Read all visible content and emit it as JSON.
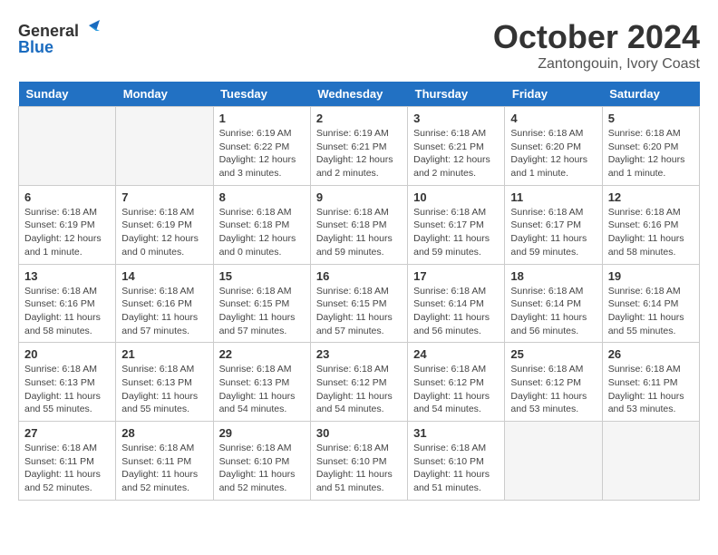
{
  "logo": {
    "line1": "General",
    "line2": "Blue"
  },
  "title": "October 2024",
  "location": "Zantongouin, Ivory Coast",
  "weekdays": [
    "Sunday",
    "Monday",
    "Tuesday",
    "Wednesday",
    "Thursday",
    "Friday",
    "Saturday"
  ],
  "weeks": [
    [
      {
        "day": "",
        "detail": ""
      },
      {
        "day": "",
        "detail": ""
      },
      {
        "day": "1",
        "detail": "Sunrise: 6:19 AM\nSunset: 6:22 PM\nDaylight: 12 hours\nand 3 minutes."
      },
      {
        "day": "2",
        "detail": "Sunrise: 6:19 AM\nSunset: 6:21 PM\nDaylight: 12 hours\nand 2 minutes."
      },
      {
        "day": "3",
        "detail": "Sunrise: 6:18 AM\nSunset: 6:21 PM\nDaylight: 12 hours\nand 2 minutes."
      },
      {
        "day": "4",
        "detail": "Sunrise: 6:18 AM\nSunset: 6:20 PM\nDaylight: 12 hours\nand 1 minute."
      },
      {
        "day": "5",
        "detail": "Sunrise: 6:18 AM\nSunset: 6:20 PM\nDaylight: 12 hours\nand 1 minute."
      }
    ],
    [
      {
        "day": "6",
        "detail": "Sunrise: 6:18 AM\nSunset: 6:19 PM\nDaylight: 12 hours\nand 1 minute."
      },
      {
        "day": "7",
        "detail": "Sunrise: 6:18 AM\nSunset: 6:19 PM\nDaylight: 12 hours\nand 0 minutes."
      },
      {
        "day": "8",
        "detail": "Sunrise: 6:18 AM\nSunset: 6:18 PM\nDaylight: 12 hours\nand 0 minutes."
      },
      {
        "day": "9",
        "detail": "Sunrise: 6:18 AM\nSunset: 6:18 PM\nDaylight: 11 hours\nand 59 minutes."
      },
      {
        "day": "10",
        "detail": "Sunrise: 6:18 AM\nSunset: 6:17 PM\nDaylight: 11 hours\nand 59 minutes."
      },
      {
        "day": "11",
        "detail": "Sunrise: 6:18 AM\nSunset: 6:17 PM\nDaylight: 11 hours\nand 59 minutes."
      },
      {
        "day": "12",
        "detail": "Sunrise: 6:18 AM\nSunset: 6:16 PM\nDaylight: 11 hours\nand 58 minutes."
      }
    ],
    [
      {
        "day": "13",
        "detail": "Sunrise: 6:18 AM\nSunset: 6:16 PM\nDaylight: 11 hours\nand 58 minutes."
      },
      {
        "day": "14",
        "detail": "Sunrise: 6:18 AM\nSunset: 6:16 PM\nDaylight: 11 hours\nand 57 minutes."
      },
      {
        "day": "15",
        "detail": "Sunrise: 6:18 AM\nSunset: 6:15 PM\nDaylight: 11 hours\nand 57 minutes."
      },
      {
        "day": "16",
        "detail": "Sunrise: 6:18 AM\nSunset: 6:15 PM\nDaylight: 11 hours\nand 57 minutes."
      },
      {
        "day": "17",
        "detail": "Sunrise: 6:18 AM\nSunset: 6:14 PM\nDaylight: 11 hours\nand 56 minutes."
      },
      {
        "day": "18",
        "detail": "Sunrise: 6:18 AM\nSunset: 6:14 PM\nDaylight: 11 hours\nand 56 minutes."
      },
      {
        "day": "19",
        "detail": "Sunrise: 6:18 AM\nSunset: 6:14 PM\nDaylight: 11 hours\nand 55 minutes."
      }
    ],
    [
      {
        "day": "20",
        "detail": "Sunrise: 6:18 AM\nSunset: 6:13 PM\nDaylight: 11 hours\nand 55 minutes."
      },
      {
        "day": "21",
        "detail": "Sunrise: 6:18 AM\nSunset: 6:13 PM\nDaylight: 11 hours\nand 55 minutes."
      },
      {
        "day": "22",
        "detail": "Sunrise: 6:18 AM\nSunset: 6:13 PM\nDaylight: 11 hours\nand 54 minutes."
      },
      {
        "day": "23",
        "detail": "Sunrise: 6:18 AM\nSunset: 6:12 PM\nDaylight: 11 hours\nand 54 minutes."
      },
      {
        "day": "24",
        "detail": "Sunrise: 6:18 AM\nSunset: 6:12 PM\nDaylight: 11 hours\nand 54 minutes."
      },
      {
        "day": "25",
        "detail": "Sunrise: 6:18 AM\nSunset: 6:12 PM\nDaylight: 11 hours\nand 53 minutes."
      },
      {
        "day": "26",
        "detail": "Sunrise: 6:18 AM\nSunset: 6:11 PM\nDaylight: 11 hours\nand 53 minutes."
      }
    ],
    [
      {
        "day": "27",
        "detail": "Sunrise: 6:18 AM\nSunset: 6:11 PM\nDaylight: 11 hours\nand 52 minutes."
      },
      {
        "day": "28",
        "detail": "Sunrise: 6:18 AM\nSunset: 6:11 PM\nDaylight: 11 hours\nand 52 minutes."
      },
      {
        "day": "29",
        "detail": "Sunrise: 6:18 AM\nSunset: 6:10 PM\nDaylight: 11 hours\nand 52 minutes."
      },
      {
        "day": "30",
        "detail": "Sunrise: 6:18 AM\nSunset: 6:10 PM\nDaylight: 11 hours\nand 51 minutes."
      },
      {
        "day": "31",
        "detail": "Sunrise: 6:18 AM\nSunset: 6:10 PM\nDaylight: 11 hours\nand 51 minutes."
      },
      {
        "day": "",
        "detail": ""
      },
      {
        "day": "",
        "detail": ""
      }
    ]
  ]
}
